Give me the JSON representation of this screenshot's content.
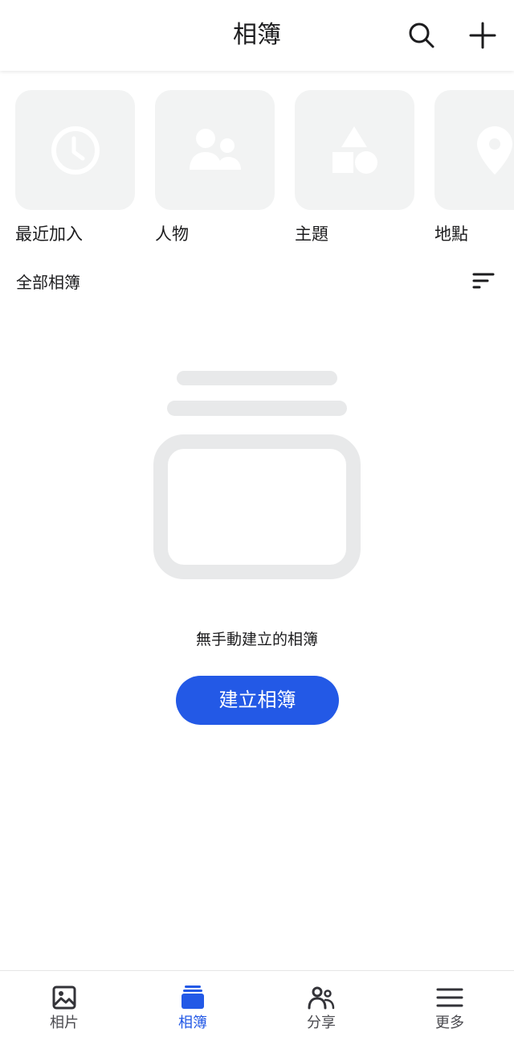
{
  "header": {
    "title": "相簿"
  },
  "categories": [
    {
      "label": "最近加入",
      "icon": "clock-icon"
    },
    {
      "label": "人物",
      "icon": "people-icon"
    },
    {
      "label": "主題",
      "icon": "shapes-icon"
    },
    {
      "label": "地點",
      "icon": "location-pin-icon"
    }
  ],
  "section": {
    "title": "全部相簿"
  },
  "empty_state": {
    "message": "無手動建立的相簿",
    "button_label": "建立相簿"
  },
  "bottom_nav": {
    "items": [
      {
        "label": "相片",
        "icon": "photo-icon"
      },
      {
        "label": "相簿",
        "icon": "albums-icon",
        "active": true
      },
      {
        "label": "分享",
        "icon": "share-people-icon"
      },
      {
        "label": "更多",
        "icon": "menu-icon"
      }
    ]
  },
  "colors": {
    "accent": "#2359e6",
    "tile_bg": "#f2f3f3",
    "placeholder": "#e8e9ea",
    "text": "#1c1c1e"
  }
}
